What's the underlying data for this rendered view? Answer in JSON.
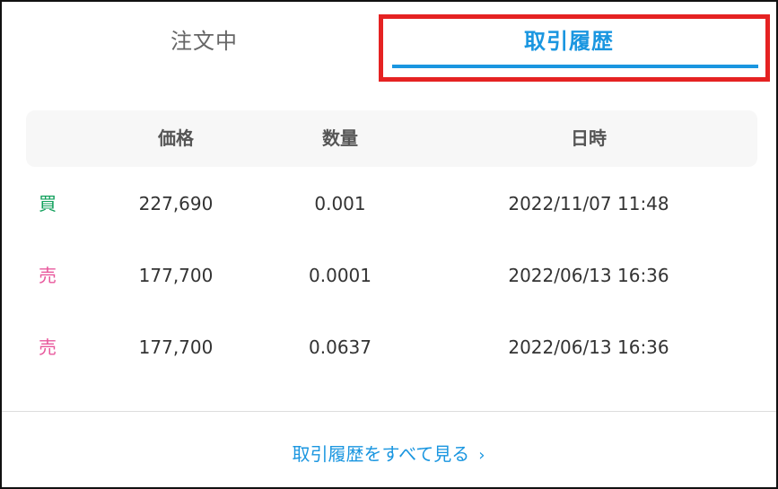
{
  "tabs": [
    {
      "label": "注文中",
      "active": false
    },
    {
      "label": "取引履歴",
      "active": true
    }
  ],
  "table": {
    "headers": {
      "price": "価格",
      "quantity": "数量",
      "datetime": "日時"
    },
    "rows": [
      {
        "side": "買",
        "side_type": "buy",
        "price": "227,690",
        "quantity": "0.001",
        "datetime": "2022/11/07 11:48"
      },
      {
        "side": "売",
        "side_type": "sell",
        "price": "177,700",
        "quantity": "0.0001",
        "datetime": "2022/06/13 16:36"
      },
      {
        "side": "売",
        "side_type": "sell",
        "price": "177,700",
        "quantity": "0.0637",
        "datetime": "2022/06/13 16:36"
      }
    ]
  },
  "footer": {
    "link_label": "取引履歴をすべて見る",
    "chevron_icon": "chevron-right-icon"
  },
  "colors": {
    "accent": "#1a96e0",
    "buy": "#12a05c",
    "sell": "#e8589c",
    "highlight": "#e52222"
  }
}
